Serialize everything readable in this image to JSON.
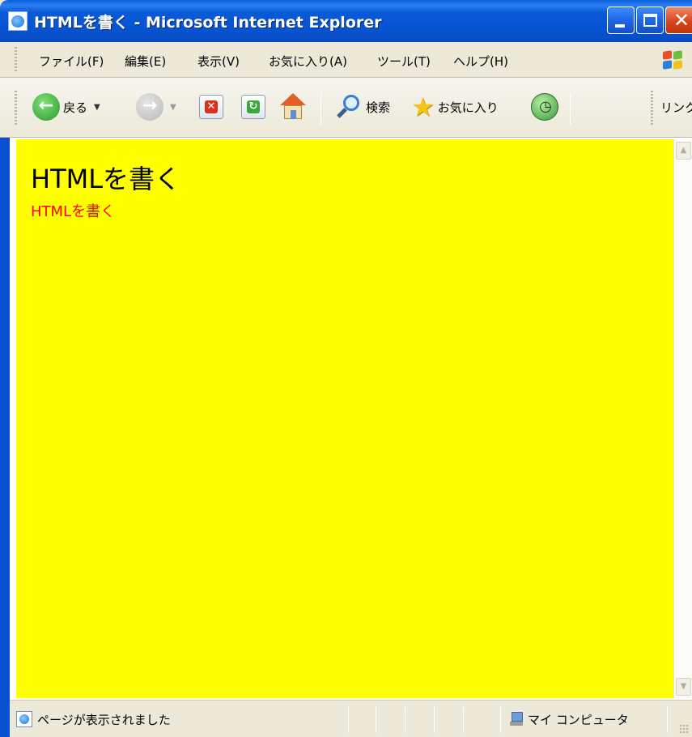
{
  "window": {
    "title": "HTMLを書く - Microsoft Internet Explorer"
  },
  "menubar": {
    "items": [
      {
        "label": "ファイル(F)"
      },
      {
        "label": "編集(E)"
      },
      {
        "label": "表示(V)"
      },
      {
        "label": "お気に入り(A)"
      },
      {
        "label": "ツール(T)"
      },
      {
        "label": "ヘルプ(H)"
      }
    ]
  },
  "toolbar": {
    "back_label": "戻る",
    "search_label": "検索",
    "favorites_label": "お気に入り",
    "links_label": "リンク"
  },
  "page": {
    "heading": "HTMLを書く",
    "subtext": "HTMLを書く",
    "background_color": "#ffff00",
    "subtext_color": "#ff0000"
  },
  "statusbar": {
    "status_text": "ページが表示されました",
    "zone_text": "マイ コンピュータ"
  }
}
